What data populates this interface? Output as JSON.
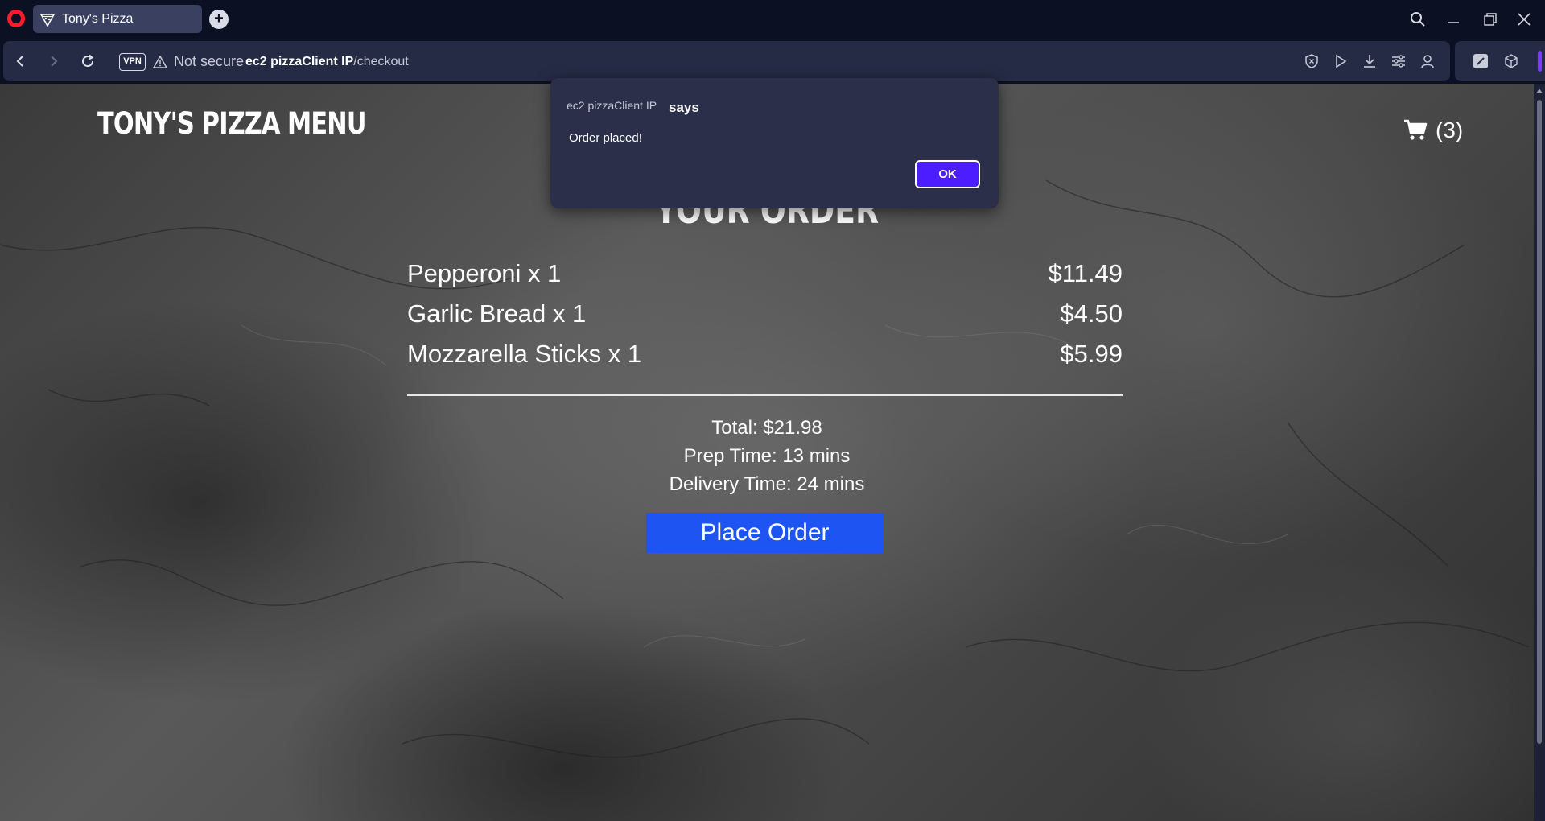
{
  "browser": {
    "tab_title": "Tony's Pizza",
    "new_tab_label": "+",
    "vpn_label": "VPN",
    "security_text": "Not secure",
    "url_host": "ec2 pizzaClient IP",
    "url_path": "/checkout"
  },
  "header": {
    "brand": "TONY'S PIZZA",
    "menu_link": "MENU",
    "cart_count": "(3)"
  },
  "order": {
    "title": "YOUR ORDER",
    "items": [
      {
        "name": "Pepperoni x 1",
        "price": "$11.49"
      },
      {
        "name": "Garlic Bread x 1",
        "price": "$4.50"
      },
      {
        "name": "Mozzarella Sticks x 1",
        "price": "$5.99"
      }
    ],
    "total": "Total: $21.98",
    "prep_time": "Prep Time: 13 mins",
    "delivery_time": "Delivery Time: 24 mins",
    "place_order_label": "Place Order"
  },
  "dialog": {
    "origin": "ec2 pizzaClient IP",
    "says": "says",
    "message": "Order placed!",
    "ok_label": "OK"
  },
  "colors": {
    "browser_bg": "#0b1022",
    "address_bar": "#262b45",
    "place_order_button": "#1d54f2",
    "dialog_ok_button": "#4b1dff",
    "opera_red": "#ff1b2d"
  }
}
